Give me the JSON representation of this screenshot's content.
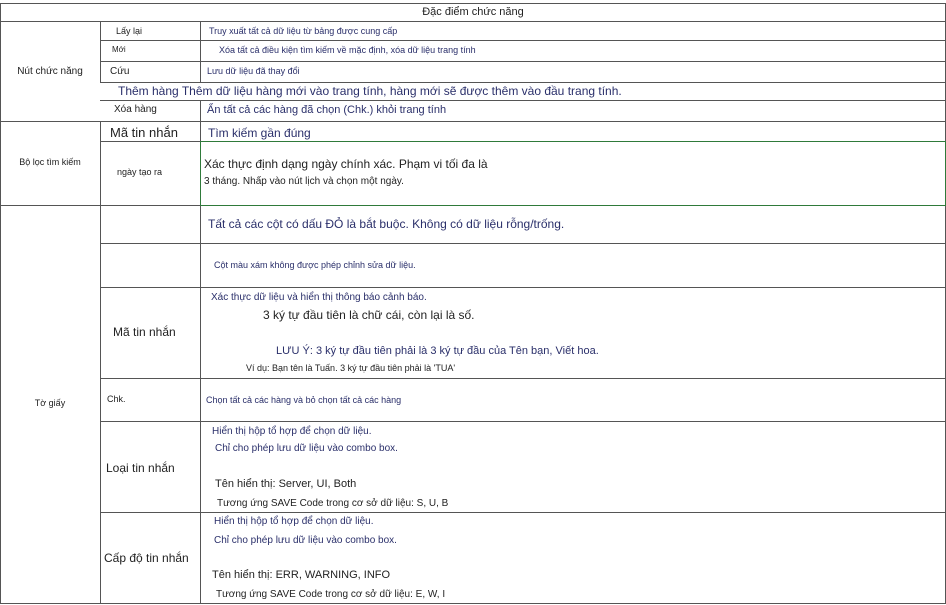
{
  "header": {
    "title": "Đặc điểm chức năng"
  },
  "sections": {
    "buttons": {
      "label": "Nút chức năng",
      "rows": [
        {
          "name": "Lấy lại",
          "desc": "Truy xuất tất cả dữ liệu từ bảng được cung cấp"
        },
        {
          "name": "Mới",
          "desc": "Xóa tất cả điều kiện tìm kiếm về mặc định, xóa dữ liệu trang tính"
        },
        {
          "name": "Cứu",
          "desc": "Lưu dữ liệu đã thay đổi"
        },
        {
          "name": "",
          "desc": "Thêm hàng Thêm dữ liệu hàng mới vào trang tính, hàng mới sẽ được thêm vào đầu trang tính."
        },
        {
          "name": "Xóa hàng",
          "desc": "Ẩn tất cả các hàng đã chọn (Chk.) khỏi trang tính"
        }
      ]
    },
    "filter": {
      "label": "Bộ lọc tìm kiếm",
      "rows": [
        {
          "name": "Mã tin nhắn",
          "desc": "Tìm kiếm gần đúng"
        },
        {
          "name": "ngày tạo ra",
          "desc_lines": [
            "Xác thực định dạng ngày chính xác. Phạm vi tối đa là",
            "3 tháng. Nhấp vào nút lịch và chọn một ngày."
          ]
        }
      ]
    },
    "sheet": {
      "label": "Tờ giấy",
      "rows": [
        {
          "name": "",
          "desc": "Tất cả các cột có dấu ĐỎ là bắt buộc. Không có dữ liệu rỗng/trống."
        },
        {
          "name": "",
          "desc": "Cột màu xám không được phép chỉnh sửa dữ liệu."
        },
        {
          "name": "Mã tin nhắn",
          "desc_lines": [
            "Xác thực dữ liệu và hiển thị thông báo cảnh báo.",
            "3 ký tự đầu tiên là chữ cái, còn lại là số.",
            "LƯU Ý: 3 ký tự đầu tiên phải là 3 ký tự đầu của Tên bạn, Viết hoa.",
            "Ví dụ: Bạn tên là Tuấn. 3 ký tự đầu tiên phải là 'TUA'"
          ]
        },
        {
          "name": "Chk.",
          "desc": "Chọn tất cả các hàng và bỏ chọn tất cả các hàng"
        },
        {
          "name": "Loại tin nhắn",
          "desc_lines": [
            "Hiển thị hộp tổ hợp để chọn dữ liệu.",
            "Chỉ cho phép lưu dữ liệu vào combo box.",
            "Tên hiển thị: Server, UI, Both",
            "Tương ứng SAVE Code trong cơ sở dữ liệu: S, U, B"
          ]
        },
        {
          "name": "Cấp độ tin nhắn",
          "desc_lines": [
            "Hiển thị hộp tổ hợp để chọn dữ liệu.",
            "Chỉ cho phép lưu dữ liệu vào combo box.",
            "Tên hiển thị: ERR, WARNING, INFO",
            "Tương ứng SAVE Code trong cơ sở dữ liệu: E, W, I"
          ]
        }
      ]
    }
  }
}
